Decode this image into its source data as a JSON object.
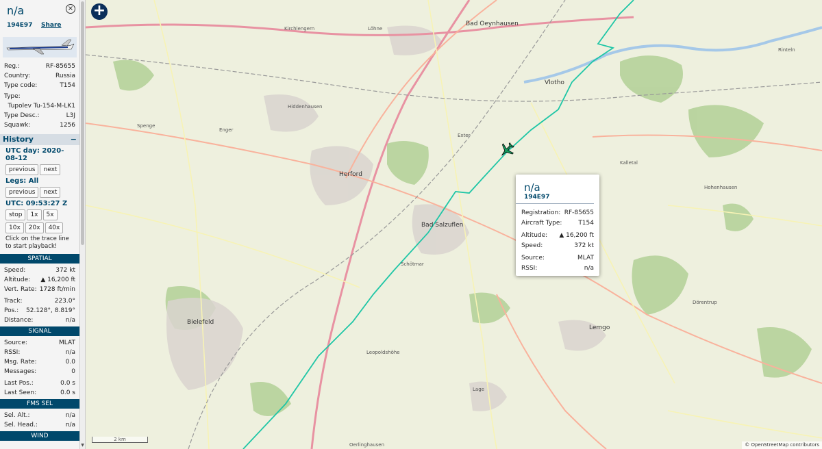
{
  "sidebar": {
    "title": "n/a",
    "hex": "194E97",
    "share": "Share",
    "info": [
      {
        "label": "Reg.:",
        "value": "RF-85655"
      },
      {
        "label": "Country:",
        "value": "Russia"
      },
      {
        "label": "Type code:",
        "value": "T154"
      }
    ],
    "type_label": "Type:",
    "type_value": "Tupolev Tu-154-M-LK1",
    "info2": [
      {
        "label": "Type Desc.:",
        "value": "L3J"
      },
      {
        "label": "Squawk:",
        "value": "1256"
      }
    ],
    "history_title": "History",
    "history_toggle": "−",
    "utc_day": "UTC day: 2020-08-12",
    "previous": "previous",
    "next": "next",
    "legs": "Legs: All",
    "utc_time": "UTC: 09:53:27 Z",
    "playback_buttons": [
      "stop",
      "1x",
      "5x",
      "10x",
      "20x",
      "40x"
    ],
    "hint": "Click on the trace line to start playback!",
    "spatial_title": "SPATIAL",
    "spatial": [
      {
        "label": "Speed:",
        "value": "372 kt"
      },
      {
        "label": "Altitude:",
        "value": "▲ 16,200 ft"
      },
      {
        "label": "Vert. Rate:",
        "value": "1728 ft/min"
      },
      {
        "label": "Track:",
        "value": "223.0°"
      },
      {
        "label": "Pos.:",
        "value": "52.128°, 8.819°"
      },
      {
        "label": "Distance:",
        "value": "n/a"
      }
    ],
    "signal_title": "SIGNAL",
    "signal": [
      {
        "label": "Source:",
        "value": "MLAT"
      },
      {
        "label": "RSSI:",
        "value": "n/a"
      },
      {
        "label": "Msg. Rate:",
        "value": "0.0"
      },
      {
        "label": "Messages:",
        "value": "0"
      },
      {
        "label": "Last Pos.:",
        "value": "0.0 s"
      },
      {
        "label": "Last Seen:",
        "value": "0.0 s"
      }
    ],
    "fms_title": "FMS SEL",
    "fms": [
      {
        "label": "Sel. Alt.:",
        "value": "n/a"
      },
      {
        "label": "Sel. Head.:",
        "value": "n/a"
      }
    ],
    "wind_title": "WIND"
  },
  "popup": {
    "title": "n/a",
    "hex": "194E97",
    "rows": [
      {
        "label": "Registration:",
        "value": "RF-85655"
      },
      {
        "label": "Aircraft Type:",
        "value": "T154"
      },
      {
        "label": "Altitude:",
        "value": "▲ 16,200 ft"
      },
      {
        "label": "Speed:",
        "value": "372 kt"
      },
      {
        "label": "Source:",
        "value": "MLAT"
      },
      {
        "label": "RSSI:",
        "value": "n/a"
      }
    ]
  },
  "map": {
    "zoom_in": "+",
    "scale": "2 km",
    "attribution": "© OpenStreetMap contributors",
    "towns": [
      {
        "name": "Herford",
        "big": true
      },
      {
        "name": "Bad Salzuflen",
        "big": true
      },
      {
        "name": "Vlotho",
        "big": true
      },
      {
        "name": "Lemgo",
        "big": true
      },
      {
        "name": "Bielefeld",
        "big": true
      },
      {
        "name": "Bad Oeynhausen",
        "big": true
      },
      {
        "name": "Hiddenhausen",
        "big": false
      },
      {
        "name": "Enger",
        "big": false
      },
      {
        "name": "Spenge",
        "big": false
      },
      {
        "name": "Lage",
        "big": false
      },
      {
        "name": "Leopoldshöhe",
        "big": false
      },
      {
        "name": "Kirchlengern",
        "big": false
      },
      {
        "name": "Löhne",
        "big": false
      },
      {
        "name": "Rinteln",
        "big": false
      },
      {
        "name": "Hohenhausen",
        "big": false
      },
      {
        "name": "Dörentrup",
        "big": false
      },
      {
        "name": "Oerlinghausen",
        "big": false
      },
      {
        "name": "Schötmar",
        "big": false
      },
      {
        "name": "Kalletal",
        "big": false
      },
      {
        "name": "Exter",
        "big": false
      }
    ],
    "colors": {
      "trace": "#1fc6a6",
      "aircraft": "#14a060",
      "header": "#00486b"
    }
  }
}
